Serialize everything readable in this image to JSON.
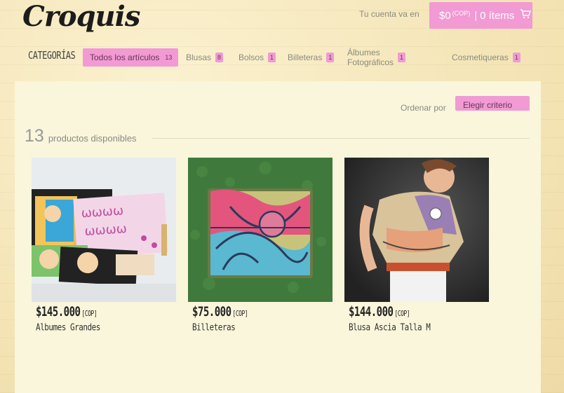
{
  "brand": {
    "logo_text": "Croquis"
  },
  "header": {
    "account_label": "Tu cuenta va en",
    "cart": {
      "amount": "$0",
      "currency": "(COP)",
      "separator": "|",
      "items": "0 ítems",
      "icon": "cart-icon"
    }
  },
  "categories": {
    "title": "CATEGORÍAS",
    "items": [
      {
        "label": "Todos los artículos",
        "count": "13",
        "active": true
      },
      {
        "label": "Blusas",
        "count": "8"
      },
      {
        "label": "Bolsos",
        "count": "1"
      },
      {
        "label": "Billeteras",
        "count": "1"
      },
      {
        "label": "Álbumes Fotográficos",
        "count": "1"
      },
      {
        "label": "Cosmetiqueras",
        "count": "1"
      }
    ]
  },
  "sort": {
    "label": "Ordenar por",
    "button": "Elegir criterio"
  },
  "listing": {
    "count": "13",
    "count_label": "productos disponibles"
  },
  "products": [
    {
      "price": "$145.000",
      "currency": "[COP]",
      "name": "Albumes Grandes"
    },
    {
      "price": "$75.000",
      "currency": "[COP]",
      "name": "Billeteras"
    },
    {
      "price": "$144.000",
      "currency": "[COP]",
      "name": "Blusa Ascia Talla M"
    }
  ],
  "colors": {
    "accent": "#f19ad3",
    "panel": "#f9f6dc",
    "background": "#f5e7bd"
  }
}
